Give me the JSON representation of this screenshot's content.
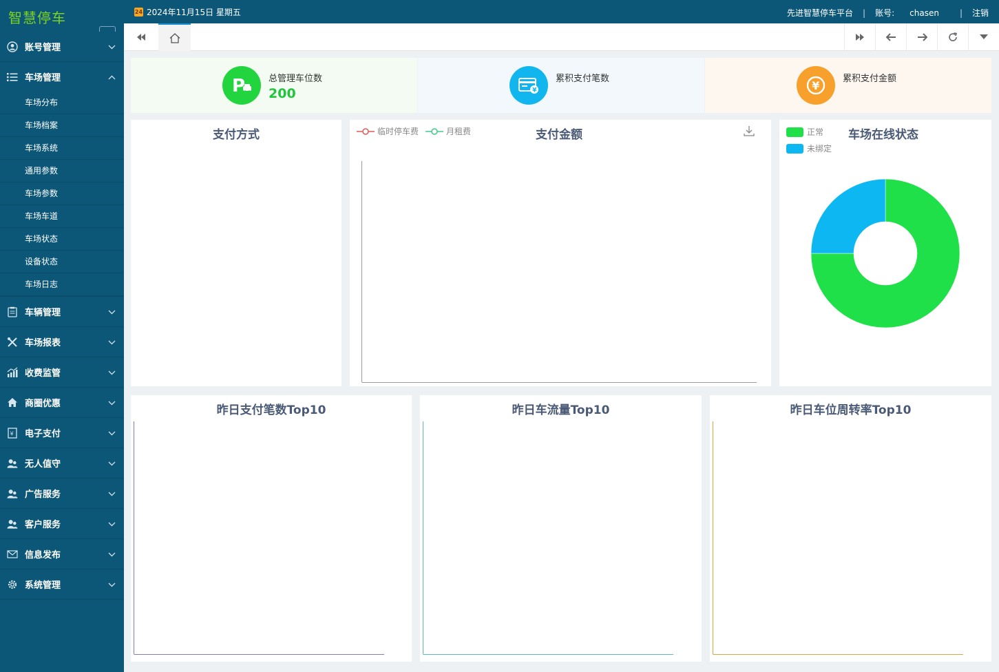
{
  "app": {
    "logo": "智慧停车"
  },
  "sidebar": {
    "groups": [
      {
        "label": "账号管理",
        "icon": "user-circle-icon",
        "expanded": false,
        "items": []
      },
      {
        "label": "车场管理",
        "icon": "list-icon",
        "expanded": true,
        "items": [
          "车场分布",
          "车场档案",
          "车场系统",
          "通用参数",
          "车场参数",
          "车场车道",
          "车场状态",
          "设备状态",
          "车场日志"
        ]
      },
      {
        "label": "车辆管理",
        "icon": "clipboard-icon",
        "expanded": false,
        "items": []
      },
      {
        "label": "车场报表",
        "icon": "tools-icon",
        "expanded": false,
        "items": []
      },
      {
        "label": "收费监管",
        "icon": "bar-chart-icon",
        "expanded": false,
        "items": []
      },
      {
        "label": "商圈优惠",
        "icon": "home-icon",
        "expanded": false,
        "items": []
      },
      {
        "label": "电子支付",
        "icon": "receipt-icon",
        "expanded": false,
        "items": []
      },
      {
        "label": "无人值守",
        "icon": "users-icon",
        "expanded": false,
        "items": []
      },
      {
        "label": "广告服务",
        "icon": "users-icon",
        "expanded": false,
        "items": []
      },
      {
        "label": "客户服务",
        "icon": "users-icon",
        "expanded": false,
        "items": []
      },
      {
        "label": "信息发布",
        "icon": "envelope-icon",
        "expanded": false,
        "items": []
      },
      {
        "label": "系统管理",
        "icon": "gear-icon",
        "expanded": false,
        "items": []
      }
    ]
  },
  "topbar": {
    "calendar_day": "24",
    "date": "2024年11月15日 星期五",
    "platform": "先进智慧停车平台",
    "account_label": "账号:",
    "account_value": "chasen",
    "logout": "注销"
  },
  "stats": [
    {
      "label": "总管理车位数",
      "value": "200",
      "icon": "parking-icon",
      "color": "#22d43e",
      "bg": "#f3fbf3"
    },
    {
      "label": "累积支付笔数",
      "value": "",
      "icon": "payment-card-icon",
      "color": "#11b6ee",
      "bg": "#f2f8fc"
    },
    {
      "label": "累积支付金额",
      "value": "",
      "icon": "yuan-icon",
      "color": "#f7a02b",
      "bg": "#fdf7f0"
    }
  ],
  "panels": {
    "pay_method": {
      "title": "支付方式"
    },
    "pay_amount": {
      "title": "支付金额",
      "legend": [
        "临时停车费",
        "月租费"
      ],
      "legend_colors": [
        "#e05a5a",
        "#3ecb8a"
      ]
    },
    "online_status": {
      "title": "车场在线状态",
      "legend": [
        "正常",
        "未绑定"
      ],
      "colors": [
        "#20e04a",
        "#0db8f2"
      ]
    },
    "top_pay": {
      "title": "昨日支付笔数Top10",
      "axis_color": "#7b7fbe"
    },
    "top_flow": {
      "title": "昨日车流量Top10",
      "axis_color": "#5bb7b8"
    },
    "top_turnover": {
      "title": "昨日车位周转率Top10",
      "axis_color": "#d9a53d"
    }
  },
  "chart_data": {
    "type": "pie",
    "title": "车场在线状态",
    "labels": [
      "正常",
      "未绑定"
    ],
    "values": [
      75,
      25
    ],
    "unit": "%",
    "legend": "top-left"
  }
}
